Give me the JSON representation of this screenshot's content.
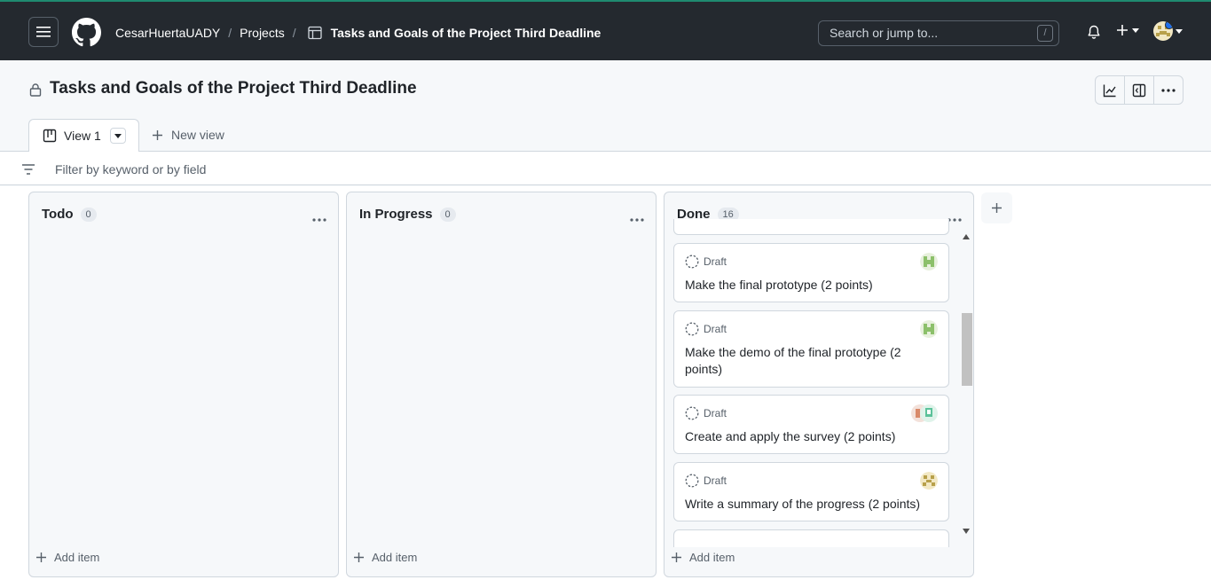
{
  "header": {
    "owner": "CesarHuertaUADY",
    "projects_link": "Projects",
    "project_name": "Tasks and Goals of the Project Third Deadline",
    "search_placeholder": "Search or jump to...",
    "search_kbd": "/"
  },
  "page": {
    "title": "Tasks and Goals of the Project Third Deadline"
  },
  "tabs": {
    "active_label": "View 1",
    "new_view_label": "New view"
  },
  "filter": {
    "placeholder": "Filter by keyword or by field"
  },
  "columns": [
    {
      "name": "Todo",
      "count": "0",
      "add_label": "Add item"
    },
    {
      "name": "In Progress",
      "count": "0",
      "add_label": "Add item"
    },
    {
      "name": "Done",
      "count": "16",
      "add_label": "Add item"
    }
  ],
  "cards": [
    {
      "status": "Draft",
      "title": "Make the final prototype (2 points)"
    },
    {
      "status": "Draft",
      "title": "Make the demo of the final prototype (2 points)"
    },
    {
      "status": "Draft",
      "title": "Create and apply the survey (2 points)"
    },
    {
      "status": "Draft",
      "title": "Write a summary of the progress (2 points)"
    }
  ],
  "colors": {
    "topbar": "#24292f",
    "accent_blue": "#1f6feb",
    "border": "#d0d7de"
  }
}
